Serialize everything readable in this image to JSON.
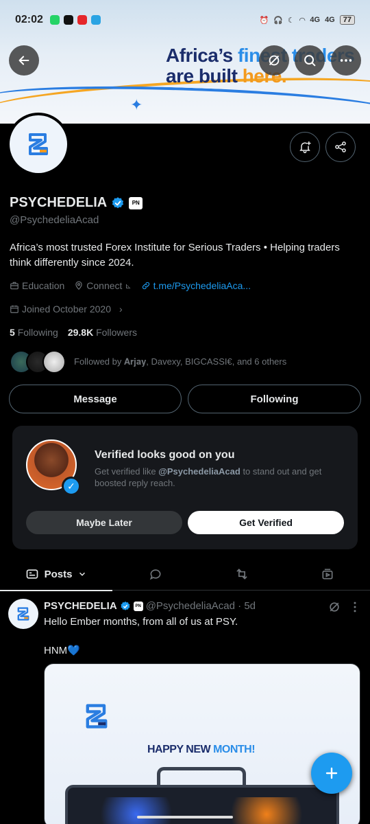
{
  "status_bar": {
    "time": "02:02",
    "network1": "4G",
    "network2": "4G",
    "battery": "77"
  },
  "banner": {
    "line1_a": "Africa’s ",
    "line1_b": "finest traders",
    "line2_a": "are built ",
    "line2_b": "here."
  },
  "profile": {
    "name": "PSYCHEDELIA",
    "affiliate_badge": "PN",
    "handle": "@PsychedeliaAcad",
    "bio": "Africa’s most trusted Forex Institute for Serious Traders • Helping traders think differently since 2024.",
    "category": "Education",
    "connect": "Connect",
    "link": "t.me/PsychedeliaAca...",
    "joined": "Joined October 2020",
    "following_count": "5",
    "following_label": "Following",
    "followers_count": "29.8K",
    "followers_label": "Followers",
    "followed_by": "Followed by 𝐀𝐫𝐣𝐚𝐲, Davexy, BIGCASSI€, and 6 others"
  },
  "actions": {
    "message": "Message",
    "following": "Following"
  },
  "verify_card": {
    "title": "Verified looks good on you",
    "desc_prefix": "Get verified like ",
    "desc_handle": "@PsychedeliaAcad",
    "desc_suffix": " to stand out and get boosted reply reach.",
    "maybe_later": "Maybe Later",
    "get_verified": "Get Verified"
  },
  "tabs": {
    "posts": "Posts"
  },
  "post": {
    "name": "PSYCHEDELIA",
    "handle_time": "@PsychedeliaAcad · 5d",
    "text": "Hello Ember months, from all of us at PSY.",
    "text2": "HNM💙",
    "image_headline_a": "HAPPY NEW ",
    "image_headline_b": "MONTH!"
  },
  "colors": {
    "accent": "#1d9bf0",
    "background": "#000000",
    "card": "#16181c",
    "muted": "#71767b"
  }
}
